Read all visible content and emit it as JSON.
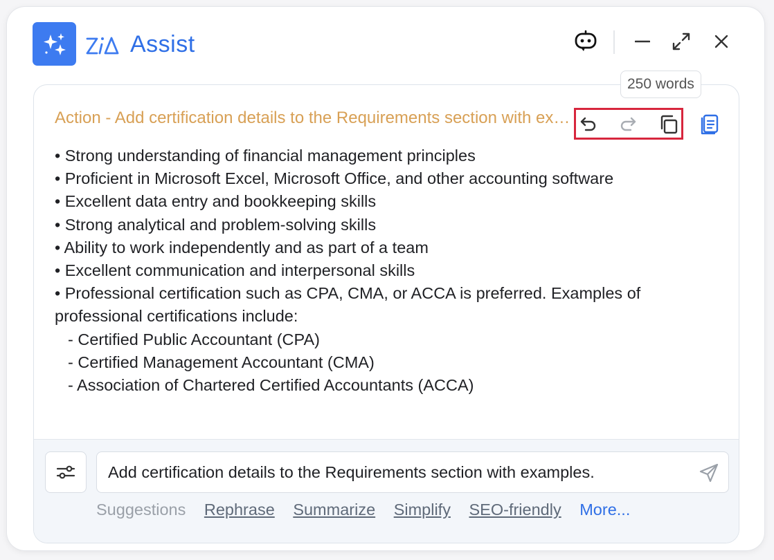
{
  "app": {
    "title": "Assist",
    "accent_color": "#3d7bf0"
  },
  "header": {
    "icons": [
      "bot-icon",
      "minimize-icon",
      "expand-icon",
      "close-icon"
    ]
  },
  "tooltip": {
    "text": "250 words"
  },
  "response": {
    "action_title": "Action - Add certification details to the Requirements section with examples",
    "lines": [
      "• Strong understanding of financial management principles",
      "• Proficient in Microsoft Excel, Microsoft Office, and other accounting software",
      "• Excellent data entry and bookkeeping skills",
      "• Strong analytical and problem-solving skills",
      "• Ability to work independently and as part of a team",
      "• Excellent communication and interpersonal skills",
      "• Professional certification such as CPA, CMA, or ACCA is preferred. Examples of professional certifications include:"
    ],
    "sub_items": [
      "- Certified Public Accountant (CPA)",
      "- Certified Management Accountant (CMA)",
      "- Association of Chartered Certified Accountants (ACCA)"
    ],
    "tools": [
      "undo-icon",
      "redo-icon",
      "copy-icon",
      "insert-icon"
    ]
  },
  "prompt": {
    "value": "Add certification details to the Requirements section with examples."
  },
  "suggestions": {
    "label": "Suggestions",
    "items": [
      "Rephrase",
      "Summarize",
      "Simplify",
      "SEO-friendly"
    ],
    "more": "More..."
  }
}
